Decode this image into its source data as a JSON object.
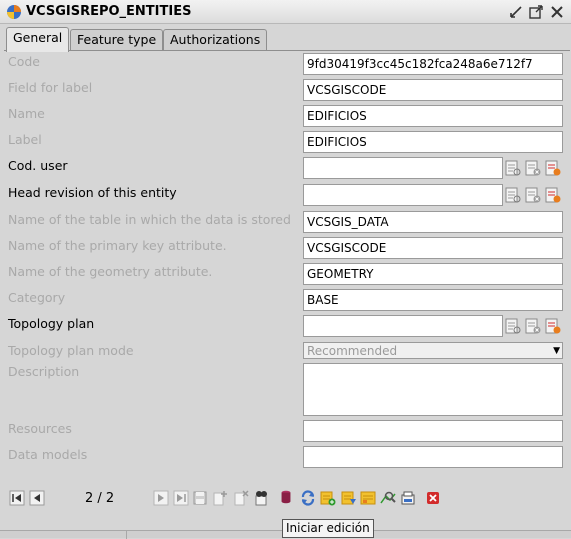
{
  "window": {
    "title": "VCSGISREPO_ENTITIES"
  },
  "tabs": [
    {
      "label": "General"
    },
    {
      "label": "Feature type"
    },
    {
      "label": "Authorizations"
    }
  ],
  "form": {
    "code": {
      "label": "Code",
      "value": "9fd30419f3cc45c182fca248a6e712f7"
    },
    "field_for_label": {
      "label": "Field for label",
      "value": "VCSGISCODE"
    },
    "name": {
      "label": "Name",
      "value": "EDIFICIOS"
    },
    "label": {
      "label": "Label",
      "value": "EDIFICIOS"
    },
    "cod_user": {
      "label": "Cod. user",
      "value": ""
    },
    "head_revision": {
      "label": "Head revision of this entity",
      "value": ""
    },
    "table_name": {
      "label": "Name of the table in which the data is stored",
      "value": "VCSGIS_DATA"
    },
    "pk_attribute": {
      "label": "Name of the primary key attribute.",
      "value": "VCSGISCODE"
    },
    "geometry_attribute": {
      "label": "Name of the geometry attribute.",
      "value": "GEOMETRY"
    },
    "category": {
      "label": "Category",
      "value": "BASE"
    },
    "topology_plan": {
      "label": "Topology plan",
      "value": ""
    },
    "topology_plan_mode": {
      "label": "Topology plan mode",
      "value": "Recommended"
    },
    "description": {
      "label": "Description",
      "value": ""
    },
    "resources": {
      "label": "Resources",
      "value": ""
    },
    "data_models": {
      "label": "Data models",
      "value": ""
    }
  },
  "navigation": {
    "record_position": "2 / 2"
  },
  "tooltip": {
    "text": "Iniciar edición"
  },
  "colors": {
    "accent_orange": "#e87d1e",
    "accent_blue": "#3a6fc4",
    "delete_red": "#d22b2b",
    "disabled_text": "#a9a9a9"
  }
}
